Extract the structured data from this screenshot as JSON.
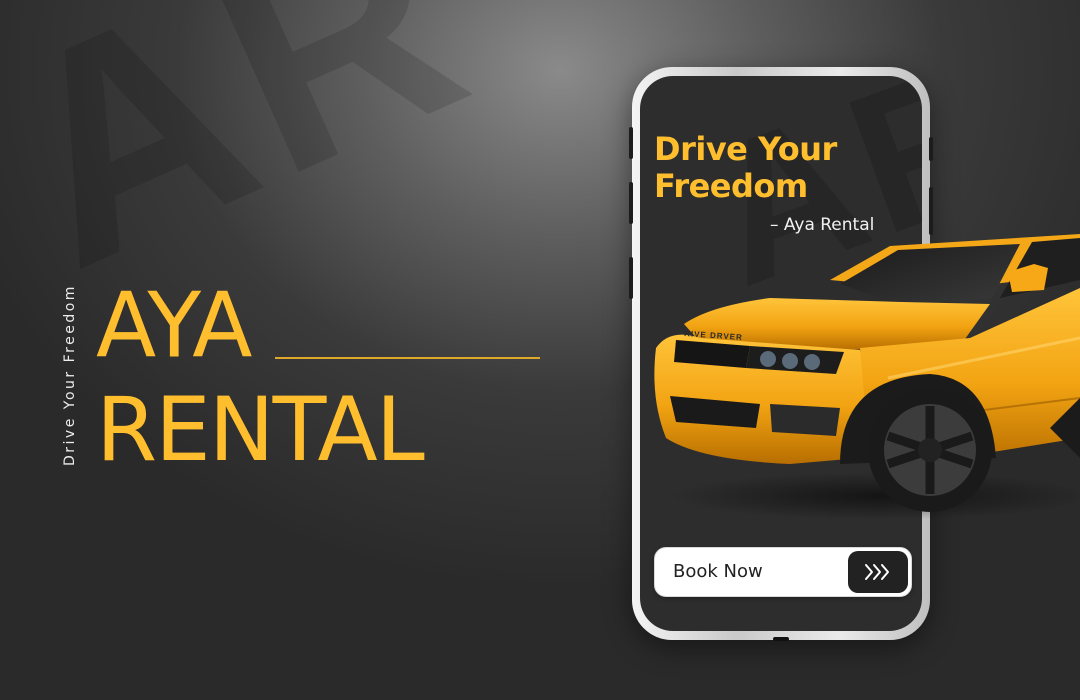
{
  "background_watermark": "AR",
  "tagline_vertical": "Drive Your Freedom",
  "brand": {
    "line1": "AYA",
    "line2": "RENTAL"
  },
  "phone": {
    "headline": "Drive Your Freedom",
    "attribution": "– Aya Rental",
    "screen_watermark": "AR",
    "car_badge_text": "RIVE DRVER",
    "book_button": {
      "label": "Book Now",
      "icon": "triple-chevron-right-icon"
    }
  },
  "colors": {
    "accent": "#ffbe2e",
    "car_body": "#f5a516",
    "screen": "#2d2d2d",
    "button_dark": "#222222"
  }
}
